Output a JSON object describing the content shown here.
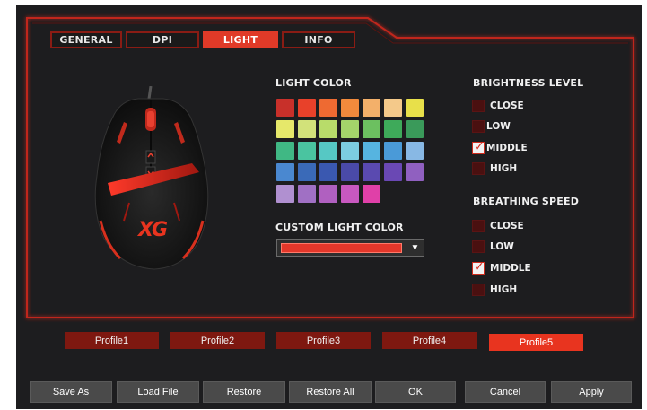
{
  "tabs": [
    {
      "label": "GENERAL",
      "active": false
    },
    {
      "label": "DPI",
      "active": false
    },
    {
      "label": "LIGHT",
      "active": true
    },
    {
      "label": "INFO",
      "active": false
    }
  ],
  "light_color": {
    "title": "LIGHT COLOR",
    "swatches": [
      [
        "#c8302a",
        "#e8412a",
        "#ee6a32",
        "#f28a3c",
        "#f3b06a",
        "#f4c98a",
        "#e8e04a"
      ],
      [
        "#e6e86a",
        "#d2e27a",
        "#b8dc6a",
        "#a4d46a",
        "#6cc060",
        "#3eaa5a",
        "#3a9a5a"
      ],
      [
        "#40b884",
        "#4ac4a0",
        "#56c8c4",
        "#7ccce0",
        "#56b4e0",
        "#4a9ad8",
        "#88b8e4"
      ],
      [
        "#4a88d0",
        "#3a6ab8",
        "#3a58b0",
        "#4a4aa8",
        "#5a4ab0",
        "#6a48b4",
        "#9060c0"
      ],
      [
        "#b090d0",
        "#a070c4",
        "#b060c0",
        "#c858c0",
        "#e040a8"
      ]
    ]
  },
  "custom_light_color": {
    "title": "CUSTOM LIGHT COLOR",
    "value_color": "#e4372a",
    "arrow_icon": "chevron-down-icon"
  },
  "brightness": {
    "title": "BRIGHTNESS LEVEL",
    "options": [
      {
        "label": "CLOSE",
        "checked": false
      },
      {
        "label": "LOW",
        "checked": false
      },
      {
        "label": "MIDDLE",
        "checked": true
      },
      {
        "label": "HIGH",
        "checked": false
      }
    ]
  },
  "breathing": {
    "title": "BREATHING SPEED",
    "options": [
      {
        "label": "CLOSE",
        "checked": false
      },
      {
        "label": "LOW",
        "checked": false
      },
      {
        "label": "MIDDLE",
        "checked": true
      },
      {
        "label": "HIGH",
        "checked": false
      }
    ]
  },
  "profiles": [
    {
      "label": "Profile1",
      "active": false
    },
    {
      "label": "Profile2",
      "active": false
    },
    {
      "label": "Profile3",
      "active": false
    },
    {
      "label": "Profile4",
      "active": false
    },
    {
      "label": "Profile5",
      "active": true
    }
  ],
  "buttons": {
    "save_as": "Save As",
    "load_file": "Load File",
    "restore": "Restore",
    "restore_all": "Restore All",
    "ok": "OK",
    "cancel": "Cancel",
    "apply": "Apply"
  },
  "mouse_logo": "XG",
  "colors": {
    "accent": "#e03a28",
    "dark_red": "#7e1810",
    "background": "#1d1d1f"
  }
}
